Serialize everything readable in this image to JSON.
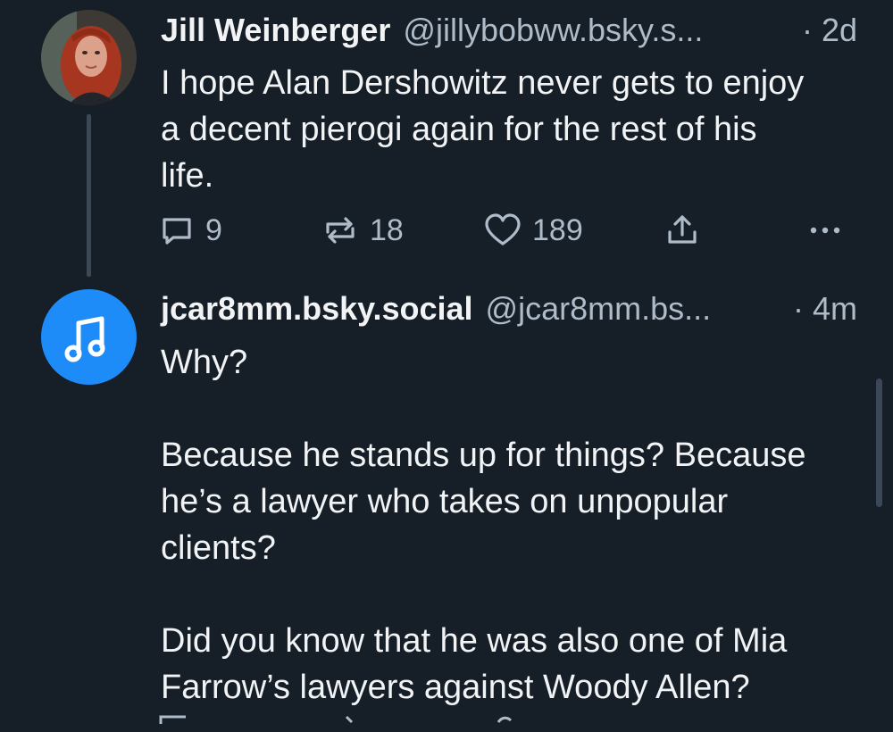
{
  "posts": [
    {
      "author_name": "Jill Weinberger",
      "handle": "@jillybobww.bsky.s...",
      "time": "· 2d",
      "text": "I hope Alan Dershowitz never gets to enjoy\na decent pierogi again for the rest of his\nlife.",
      "replies": "9",
      "reposts": "18",
      "likes": "189",
      "avatar_icon": "user-photo-avatar"
    },
    {
      "author_name": "jcar8mm.bsky.social",
      "handle": "@jcar8mm.bs...",
      "time": "· 4m",
      "text": "Why?\n\nBecause he stands up for things? Because\nhe’s a lawyer who takes on unpopular\nclients?\n\nDid you know that he was also one of Mia\nFarrow’s lawyers against Woody Allen?",
      "avatar_icon": "music-note-icon",
      "avatar_color": "#1d8cf8"
    }
  ],
  "colors": {
    "background": "#161e27",
    "text_primary": "#f1f3f5",
    "text_secondary": "#aebbc9",
    "thread_line": "#3b4857"
  }
}
